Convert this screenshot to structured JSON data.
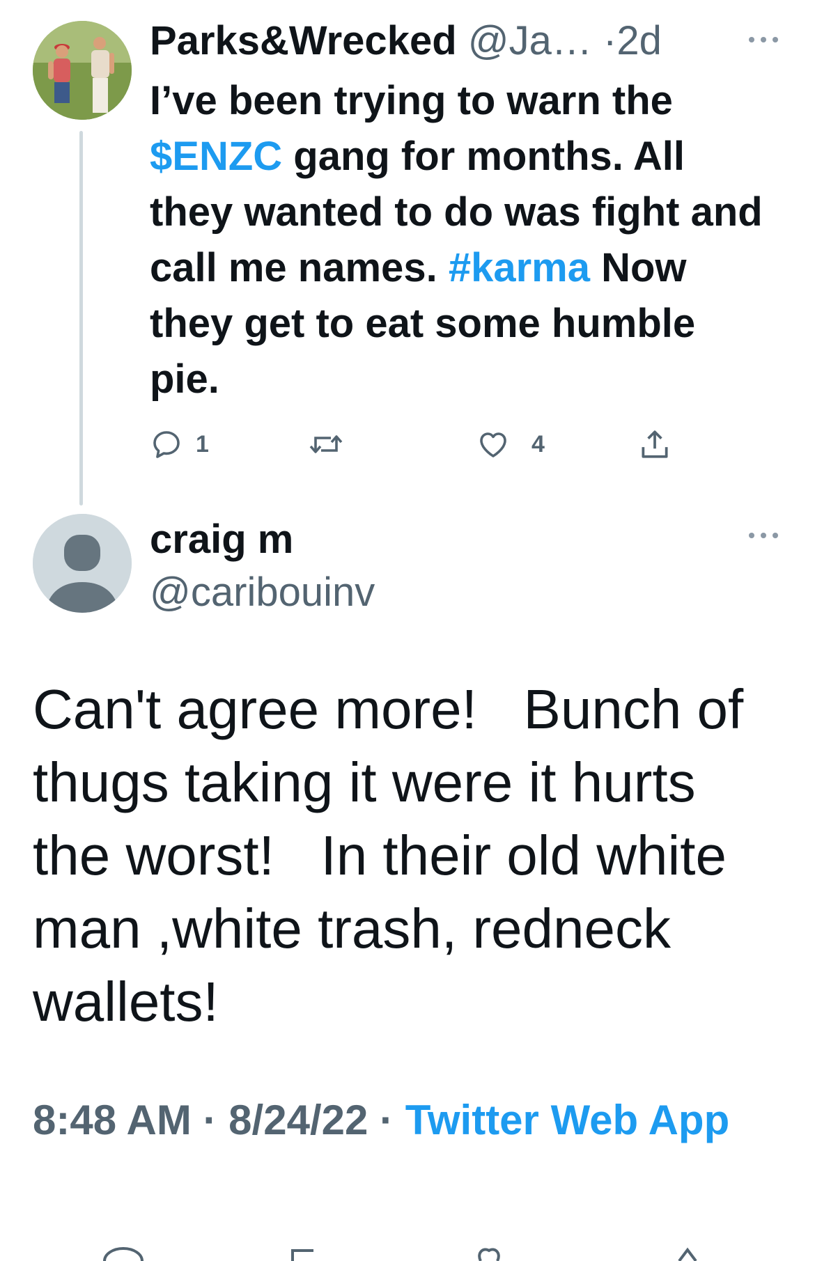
{
  "parent_tweet": {
    "display_name": "Parks&Wrecked",
    "handle": "@Ja…",
    "separator": "·",
    "time_ago": "2d",
    "text_segments": [
      {
        "text": "I’ve been trying to warn the ",
        "link": false
      },
      {
        "text": "$ENZC",
        "link": true
      },
      {
        "text": " gang for months. All they wanted to do was fight and call me names. ",
        "link": false
      },
      {
        "text": "#karma",
        "link": true
      },
      {
        "text": " Now they get to eat some humble pie.",
        "link": false
      }
    ],
    "actions": {
      "reply_icon": "reply-icon",
      "reply_count": "1",
      "retweet_icon": "retweet-icon",
      "retweet_count": "",
      "like_icon": "heart-icon",
      "like_count": "4",
      "share_icon": "share-icon"
    }
  },
  "reply_tweet": {
    "display_name": "craig m",
    "handle": "@caribouinv",
    "text": "Can't agree more!   Bunch of thugs taking it were it hurts the worst!   In their old white man ,white trash, redneck wallets!",
    "time": "8:48 AM",
    "separator": "·",
    "date": "8/24/22",
    "separator2": "·",
    "source": "Twitter Web App"
  },
  "colors": {
    "text_primary": "#0f1419",
    "text_secondary": "#536471",
    "link": "#1d9bf0",
    "divider": "#cfd9de"
  }
}
